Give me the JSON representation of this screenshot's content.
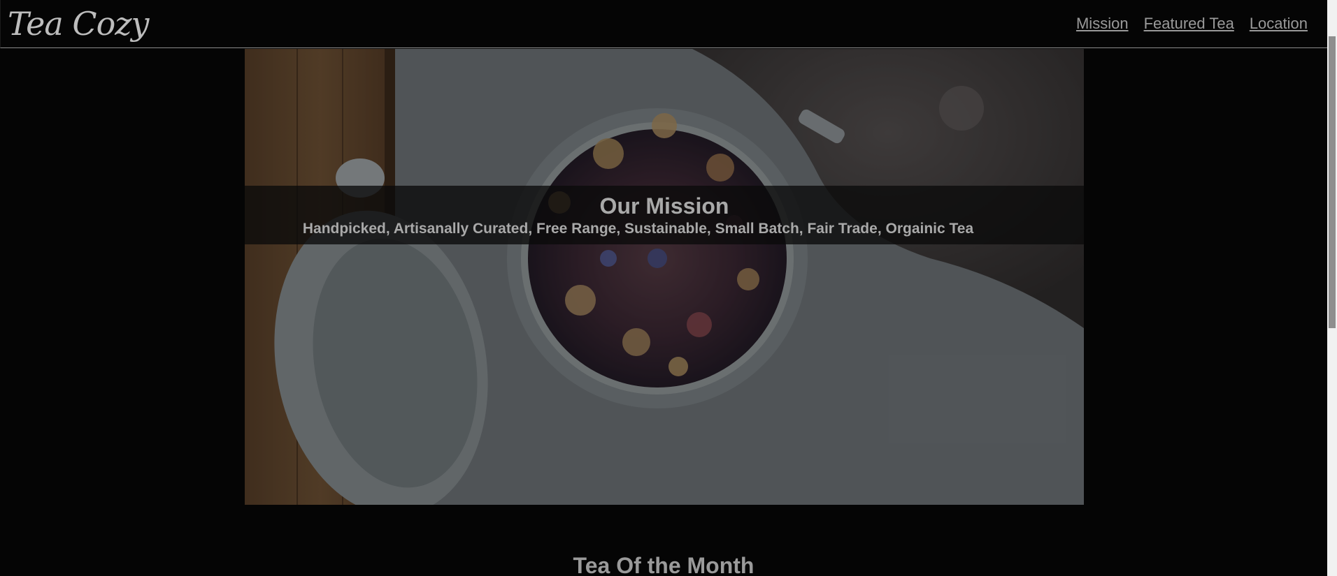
{
  "header": {
    "logo": "Tea Cozy",
    "nav": [
      {
        "label": "Mission"
      },
      {
        "label": "Featured Tea"
      },
      {
        "label": "Location"
      }
    ]
  },
  "hero": {
    "title": "Our Mission",
    "subtitle": "Handpicked, Artisanally Curated, Free Range, Sustainable, Small Batch, Fair Trade, Orgainic Tea"
  },
  "section": {
    "title": "Tea Of the Month"
  },
  "colors": {
    "background": "#050505",
    "text": "#9a9a9a",
    "nav_border": "#8c8c8c"
  }
}
